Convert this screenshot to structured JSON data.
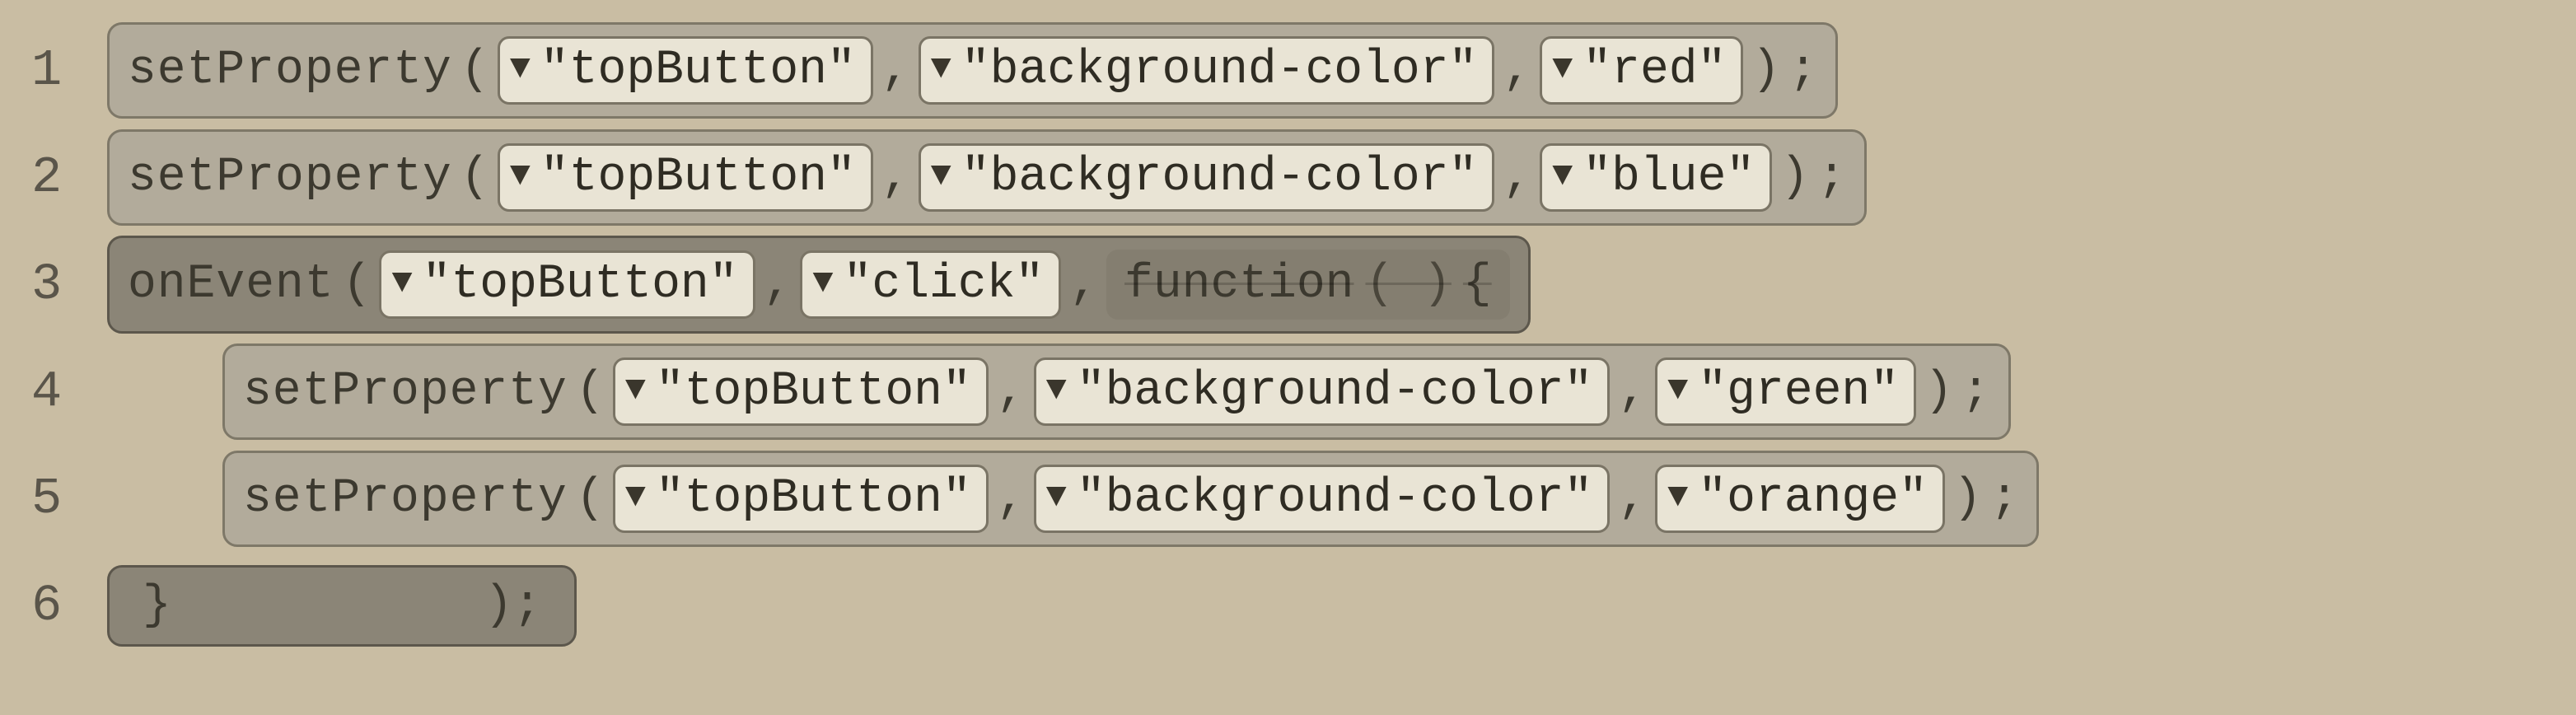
{
  "lines": {
    "l1": {
      "no": "1"
    },
    "l2": {
      "no": "2"
    },
    "l3": {
      "no": "3"
    },
    "l4": {
      "no": "4"
    },
    "l5": {
      "no": "5"
    },
    "l6": {
      "no": "6"
    }
  },
  "fn": {
    "setProperty": "setProperty",
    "onEvent": "onEvent",
    "function": "function",
    "openParen": "(",
    "closeParen": ")",
    "openBrace": "{",
    "closeBrace": "}",
    "comma": ",",
    "semi": ";",
    "closeParenSemi": ");",
    "emptyParens": "( )"
  },
  "args": {
    "topButton": "\"topButton\"",
    "bgColor": "\"background-color\"",
    "red": "\"red\"",
    "blue": "\"blue\"",
    "green": "\"green\"",
    "orange": "\"orange\"",
    "click": "\"click\""
  },
  "icons": {
    "dropdown": "▼"
  }
}
